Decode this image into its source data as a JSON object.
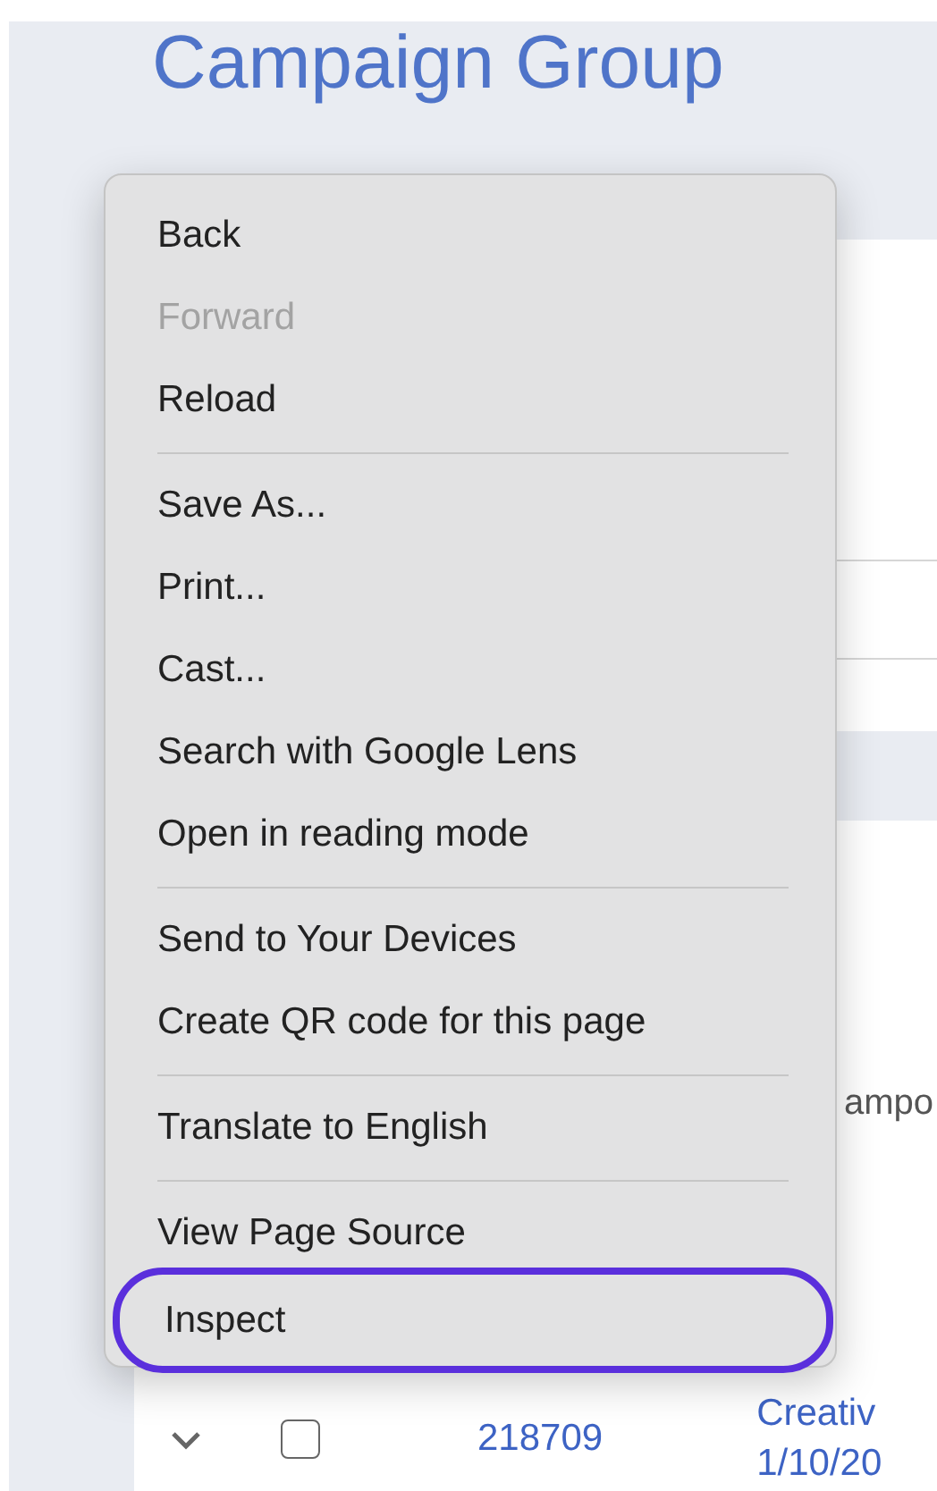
{
  "page": {
    "title": "Campaign Group",
    "table": {
      "header_fragment": "ampo",
      "rows": [
        {
          "checked": false,
          "link": "218709",
          "text_lines": [
            "Creativ",
            "1/10/20"
          ]
        }
      ]
    }
  },
  "context_menu": {
    "groups": [
      [
        {
          "label": "Back",
          "disabled": false,
          "highlighted": false
        },
        {
          "label": "Forward",
          "disabled": true,
          "highlighted": false
        },
        {
          "label": "Reload",
          "disabled": false,
          "highlighted": false
        }
      ],
      [
        {
          "label": "Save As...",
          "disabled": false,
          "highlighted": false
        },
        {
          "label": "Print...",
          "disabled": false,
          "highlighted": false
        },
        {
          "label": "Cast...",
          "disabled": false,
          "highlighted": false
        },
        {
          "label": "Search with Google Lens",
          "disabled": false,
          "highlighted": false
        },
        {
          "label": "Open in reading mode",
          "disabled": false,
          "highlighted": false
        }
      ],
      [
        {
          "label": "Send to Your Devices",
          "disabled": false,
          "highlighted": false
        },
        {
          "label": "Create QR code for this page",
          "disabled": false,
          "highlighted": false
        }
      ],
      [
        {
          "label": "Translate to English",
          "disabled": false,
          "highlighted": false
        }
      ],
      [
        {
          "label": "View Page Source",
          "disabled": false,
          "highlighted": false
        },
        {
          "label": "Inspect",
          "disabled": false,
          "highlighted": true
        }
      ]
    ]
  }
}
